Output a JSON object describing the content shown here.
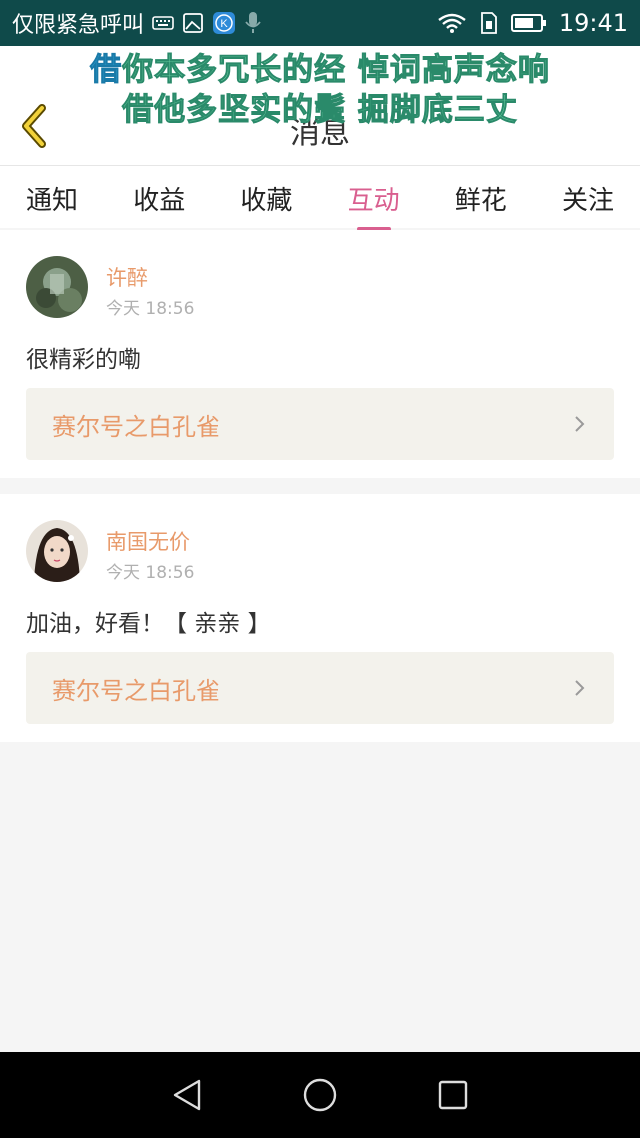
{
  "status_bar": {
    "carrier_text": "仅限紧急呼叫",
    "time": "19:41",
    "icons": [
      "keyboard-icon",
      "image-icon",
      "k-app-icon",
      "mic-icon",
      "wifi-icon",
      "sim-icon",
      "battery-icon"
    ]
  },
  "header": {
    "title": "消息",
    "lyric_line1_highlight": "借",
    "lyric_line1_rest": "你本多冗长的经 悼词高声念响",
    "lyric_line2": "借他多坚实的鬓 掘脚底三丈"
  },
  "tabs": [
    {
      "label": "通知",
      "active": false
    },
    {
      "label": "收益",
      "active": false
    },
    {
      "label": "收藏",
      "active": false
    },
    {
      "label": "互动",
      "active": true
    },
    {
      "label": "鲜花",
      "active": false
    },
    {
      "label": "关注",
      "active": false
    }
  ],
  "messages": [
    {
      "user": "许醉",
      "time": "今天 18:56",
      "comment": "很精彩的嘞",
      "ref_title": "赛尔号之白孔雀"
    },
    {
      "user": "南国无价",
      "time": "今天 18:56",
      "comment": "加油，好看！【 亲亲 】",
      "ref_title": "赛尔号之白孔雀"
    }
  ],
  "colors": {
    "accent": "#d95f8f",
    "name": "#e89a6a",
    "status_bar": "#0f4a4a"
  }
}
